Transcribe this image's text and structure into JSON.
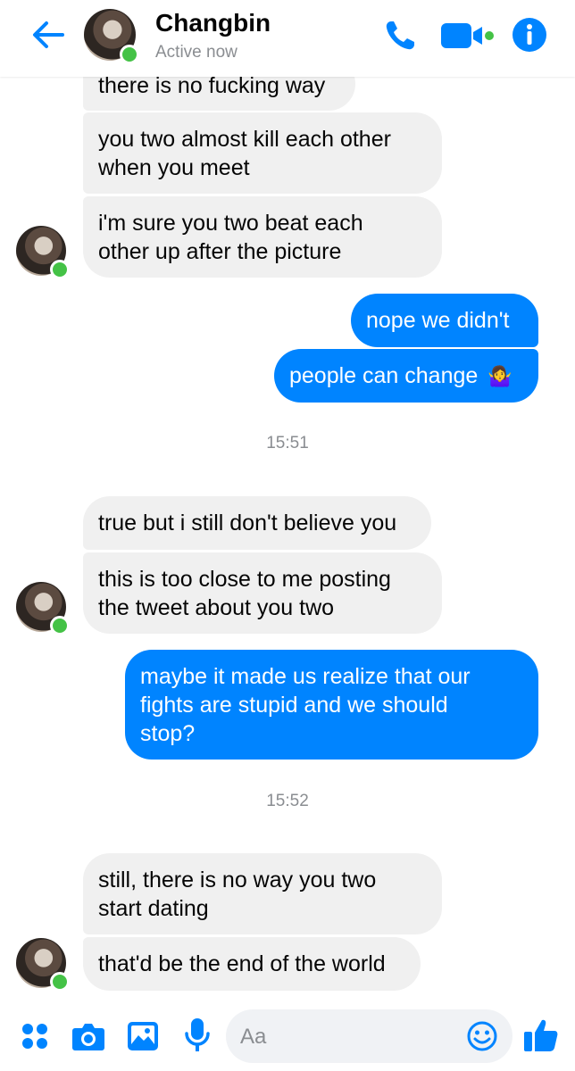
{
  "header": {
    "title": "Changbin",
    "status": "Active now"
  },
  "messages": [
    {
      "direction": "in",
      "text": "there is no fucking way"
    },
    {
      "direction": "in",
      "text": "you two almost kill each other\nwhen you meet"
    },
    {
      "direction": "in",
      "text": "i'm sure you two beat each\nother up after the picture"
    },
    {
      "direction": "out",
      "text": "nope we didn't"
    },
    {
      "direction": "out",
      "text": "people can change",
      "emoji": "🤷‍♀️"
    },
    {
      "direction": "in",
      "text": "true but i still don't believe you"
    },
    {
      "direction": "in",
      "text": "this is too close to me posting\nthe tweet about you two"
    },
    {
      "direction": "out",
      "text": "maybe it made us realize that our\nfights are stupid and we should\nstop?"
    },
    {
      "direction": "in",
      "text": "still, there is no way you two\nstart dating"
    },
    {
      "direction": "in",
      "text": "that'd be the end of the world"
    }
  ],
  "timestamps": [
    "15:51",
    "15:52"
  ],
  "composer": {
    "placeholder": "Aa"
  },
  "colors": {
    "accent": "#0084ff",
    "incoming_bubble": "#f0f0f0",
    "online": "#44c246"
  },
  "icons": [
    "back-arrow-icon",
    "phone-icon",
    "video-camera-icon",
    "info-icon",
    "apps-grid-icon",
    "camera-icon",
    "image-icon",
    "microphone-icon",
    "emoji-icon",
    "thumbs-up-icon"
  ]
}
